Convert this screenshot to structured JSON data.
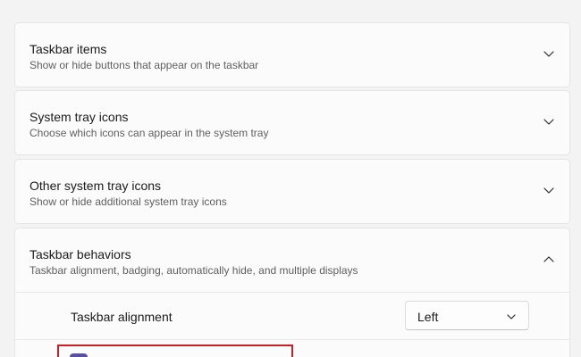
{
  "sections": [
    {
      "title": "Taskbar items",
      "subtitle": "Show or hide buttons that appear on the taskbar",
      "expanded": false
    },
    {
      "title": "System tray icons",
      "subtitle": "Choose which icons can appear in the system tray",
      "expanded": false
    },
    {
      "title": "Other system tray icons",
      "subtitle": "Show or hide additional system tray icons",
      "expanded": false
    },
    {
      "title": "Taskbar behaviors",
      "subtitle": "Taskbar alignment, badging, automatically hide, and multiple displays",
      "expanded": true
    }
  ],
  "behaviors": {
    "alignment_label": "Taskbar alignment",
    "alignment_value": "Left"
  },
  "icons": {
    "collapsed": "chevron-down-icon",
    "expanded": "chevron-up-icon",
    "dropdown": "chevron-down-icon"
  },
  "colors": {
    "highlight": "#c8202a",
    "accent": "#5a4fa1"
  }
}
